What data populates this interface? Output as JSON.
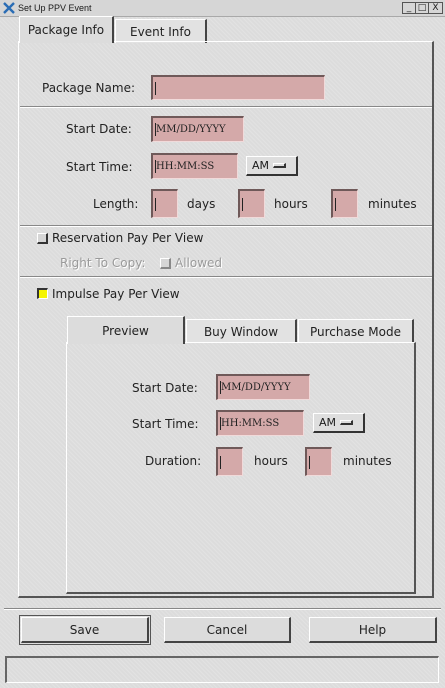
{
  "window": {
    "title": "Set Up PPV Event",
    "controls": [
      "_",
      "□",
      "X"
    ]
  },
  "tabs": [
    {
      "label": "Package Info",
      "active": true
    },
    {
      "label": "Event Info",
      "active": false
    }
  ],
  "package": {
    "name_label": "Package Name:",
    "name_value": "",
    "start_date_label": "Start Date:",
    "start_date_placeholder": "MM/DD/YYYY",
    "start_time_label": "Start Time:",
    "start_time_placeholder": "HH:MM:SS",
    "ampm": "AM",
    "length_label": "Length:",
    "days_label": "days",
    "hours_label": "hours",
    "minutes_label": "minutes"
  },
  "reservation": {
    "label": "Reservation Pay Per View",
    "checked": false,
    "right_to_copy_label": "Right To Copy:",
    "allowed_label": "Allowed"
  },
  "impulse": {
    "label": "Impulse Pay Per View",
    "checked": true,
    "check_color": "#f5f500"
  },
  "subtabs": [
    {
      "label": "Preview",
      "active": true
    },
    {
      "label": "Buy Window",
      "active": false
    },
    {
      "label": "Purchase Mode",
      "active": false
    }
  ],
  "preview": {
    "start_date_label": "Start Date:",
    "start_date_placeholder": "MM/DD/YYYY",
    "start_time_label": "Start Time:",
    "start_time_placeholder": "HH:MM:SS",
    "ampm": "AM",
    "duration_label": "Duration:",
    "hours_label": "hours",
    "minutes_label": "minutes"
  },
  "buttons": {
    "save": "Save",
    "cancel": "Cancel",
    "help": "Help"
  },
  "status": "",
  "colors": {
    "field_bg": "#d4a9a9",
    "window_bg": "#dcdcdc"
  },
  "icons": {
    "title": "x-app-icon"
  }
}
